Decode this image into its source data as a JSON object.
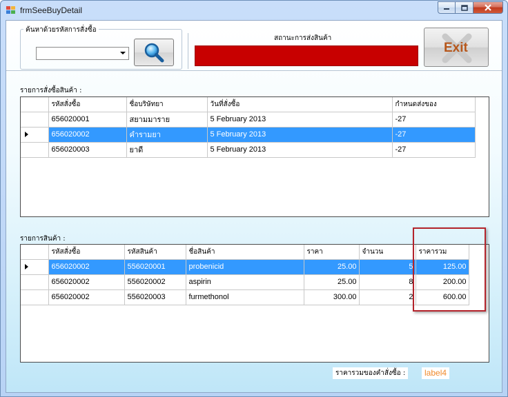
{
  "window": {
    "title": "frmSeeBuyDetail"
  },
  "search": {
    "group_label": "ค้นหาด้วยรหัสการสั่งซื้อ",
    "combo_value": "",
    "search_icon": "magnifier-icon"
  },
  "status": {
    "label": "สถานะการส่งสินค้า",
    "color": "#c80000"
  },
  "exit": {
    "label": "Exit"
  },
  "orders": {
    "label": "รายการสั่งซื้อสินค้า :",
    "columns": [
      "รหัสสั่งซื้อ",
      "ชื่อบริษัทยา",
      "วันที่สั่งซื้อ",
      "กำหนดส่งของ"
    ],
    "rows": [
      [
        "656020001",
        "สยามมาราย",
        "5 February 2013",
        "-27"
      ],
      [
        "656020002",
        "คำรามยา",
        "5 February 2013",
        "-27"
      ],
      [
        "656020003",
        "ยาดี",
        "5 February 2013",
        "-27"
      ]
    ],
    "selected_row": 1
  },
  "items": {
    "label": "รายการสินค้า :",
    "columns": [
      "รหัสสั่งซื้อ",
      "รหัสสินค้า",
      "ชื่อสินค้า",
      "ราคา",
      "จำนวน",
      "ราคารวม"
    ],
    "rows": [
      [
        "656020002",
        "556020001",
        "probenicid",
        "25.00",
        "5",
        "125.00"
      ],
      [
        "656020002",
        "556020002",
        "aspirin",
        "25.00",
        "8",
        "200.00"
      ],
      [
        "656020002",
        "556020003",
        "furmethonol",
        "300.00",
        "2",
        "600.00"
      ]
    ],
    "selected_row": 0
  },
  "total": {
    "label": "ราคารวมของคำสั่งซื้อ :",
    "value": "label4"
  }
}
